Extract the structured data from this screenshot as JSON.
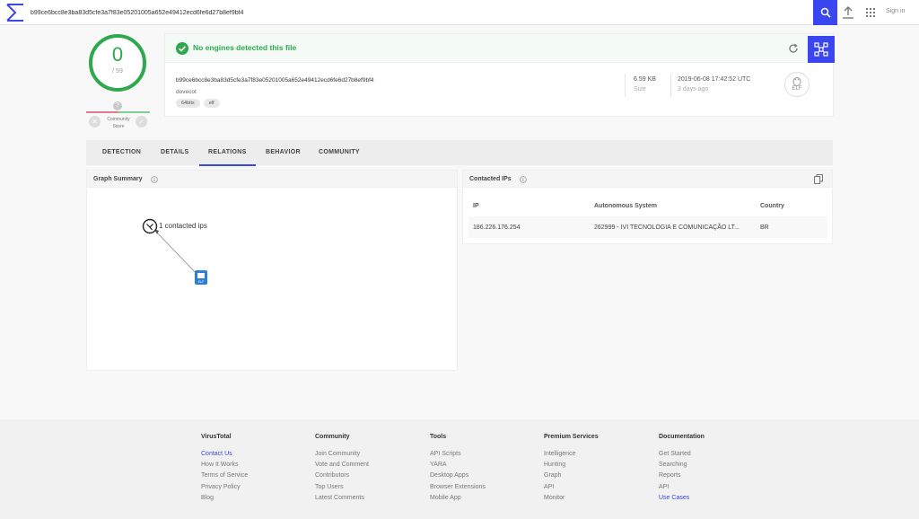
{
  "search": {
    "query": "b99ce6bcc8e3ba83d5cfe3a7f83e05201005a652e49412ecd6fe6d27b8ef9bf4"
  },
  "header": {
    "signin_label": "Sign in"
  },
  "score": {
    "detections": "0",
    "total": "/ 59",
    "community_badge": "?",
    "community_label_1": "Community",
    "community_label_2": "Score"
  },
  "file": {
    "status_text": "No engines detected this file",
    "hash": "b99ce6bcc8e3ba83d5cfe3a7f83e05201005a652e49412ecd6fe6d27b8ef9bf4",
    "name": "dovecot",
    "tags": [
      "64bits",
      "elf"
    ],
    "size_value": "6.59 KB",
    "size_label": "Size",
    "date_value": "2019-06-08 17:42:52 UTC",
    "date_label": "3 days ago",
    "type_label": "ELF"
  },
  "tabs": [
    "DETECTION",
    "DETAILS",
    "RELATIONS",
    "BEHAVIOR",
    "COMMUNITY"
  ],
  "active_tab": "RELATIONS",
  "graph": {
    "title": "Graph Summary",
    "node_label": "1 contacted ips"
  },
  "contacted_ips": {
    "title": "Contacted IPs",
    "headers": [
      "IP",
      "Autonomous System",
      "Country"
    ],
    "rows": [
      {
        "ip": "186.226.176.254",
        "as": "262999 - IVI TECNOLOGIA E COMUNICAÇÃO LT...",
        "country": "BR"
      }
    ]
  },
  "footer": {
    "columns": [
      {
        "title": "VirusTotal",
        "links": [
          "Contact Us",
          "How It Works",
          "Terms of Service",
          "Privacy Policy",
          "Blog"
        ],
        "accent_index": 0
      },
      {
        "title": "Community",
        "links": [
          "Join Community",
          "Vote and Comment",
          "Contributors",
          "Top Users",
          "Latest Comments"
        ],
        "accent_index": -1
      },
      {
        "title": "Tools",
        "links": [
          "API Scripts",
          "YARA",
          "Desktop Apps",
          "Browser Extensions",
          "Mobile App"
        ],
        "accent_index": -1
      },
      {
        "title": "Premium Services",
        "links": [
          "Intelligence",
          "Hunting",
          "Graph",
          "API",
          "Monitor"
        ],
        "accent_index": -1
      },
      {
        "title": "Documentation",
        "links": [
          "Get Started",
          "Searching",
          "Reports",
          "API",
          "Use Cases"
        ],
        "accent_index": 4
      }
    ]
  },
  "colors": {
    "accent": "#3a47f0",
    "clean": "#2fa84f"
  }
}
